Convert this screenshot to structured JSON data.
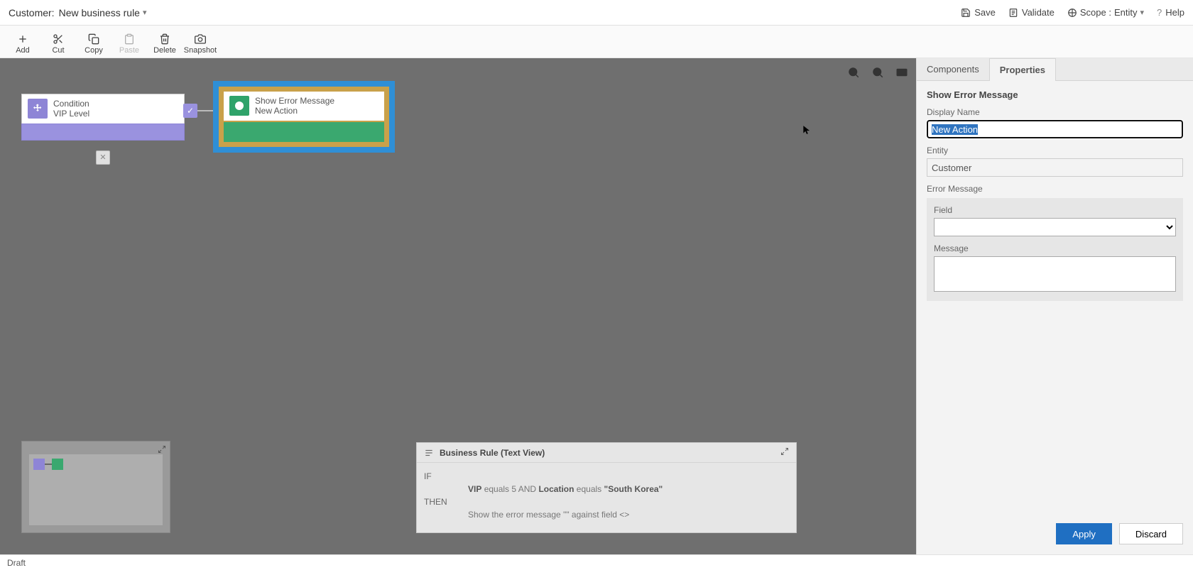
{
  "header": {
    "entity_label": "Customer:",
    "rule_name": "New business rule",
    "actions": {
      "save": "Save",
      "validate": "Validate",
      "scope_label": "Scope :",
      "scope_value": "Entity",
      "help": "Help"
    }
  },
  "ribbon": {
    "add": "Add",
    "cut": "Cut",
    "copy": "Copy",
    "paste": "Paste",
    "delete": "Delete",
    "snapshot": "Snapshot"
  },
  "canvas": {
    "condition": {
      "title": "Condition",
      "subtitle": "VIP Level"
    },
    "action": {
      "title": "Show Error Message",
      "subtitle": "New Action"
    }
  },
  "textview": {
    "title": "Business Rule (Text View)",
    "if_kw": "IF",
    "then_kw": "THEN",
    "if_parts": {
      "f1": "VIP",
      "op1": "equals",
      "v1": "5",
      "and": "AND",
      "f2": "Location",
      "op2": "equals",
      "v2": "\"South Korea\""
    },
    "then_text": "Show the error message \"\" against field <>"
  },
  "side": {
    "tabs": {
      "components": "Components",
      "properties": "Properties"
    },
    "title": "Show Error Message",
    "display_name_label": "Display Name",
    "display_name_value": "New Action",
    "entity_label": "Entity",
    "entity_value": "Customer",
    "error_section_label": "Error Message",
    "field_label": "Field",
    "message_label": "Message",
    "apply": "Apply",
    "discard": "Discard"
  },
  "status": {
    "draft": "Draft"
  }
}
